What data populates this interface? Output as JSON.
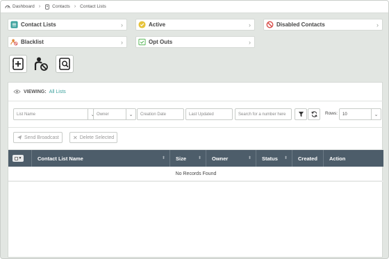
{
  "breadcrumb": {
    "items": [
      "Dashboard",
      "Contacts",
      "Contact Lists"
    ]
  },
  "categories": [
    {
      "label": "Contact Lists",
      "icon": "contact-list-icon"
    },
    {
      "label": "Active",
      "icon": "active-check-icon"
    },
    {
      "label": "Disabled Contacts",
      "icon": "disabled-icon"
    },
    {
      "label": "Blacklist",
      "icon": "blacklist-icon"
    },
    {
      "label": "Opt Outs",
      "icon": "opt-out-icon"
    }
  ],
  "colors": {
    "accent": "#3aa09c",
    "header_bg": "#4d5d6a",
    "disabled_red": "#d9534f",
    "active_yellow": "#e6c33b"
  },
  "viewing": {
    "label": "VIEWING:",
    "value": "All Lists"
  },
  "filters": {
    "list_name_placeholder": "List Name",
    "owner_placeholder": "Owner",
    "creation_date_placeholder": "Creation Date",
    "last_updated_placeholder": "Last Updated",
    "search_placeholder": "Search for a number here",
    "rows_label": "Rows:",
    "rows_value": "10"
  },
  "bulk": {
    "send_label": "Send Broadcast",
    "delete_label": "Delete Selected"
  },
  "table": {
    "columns": [
      "Contact List Name",
      "Size",
      "Owner",
      "Status",
      "Created",
      "Action"
    ],
    "empty_text": "No Records Found"
  }
}
